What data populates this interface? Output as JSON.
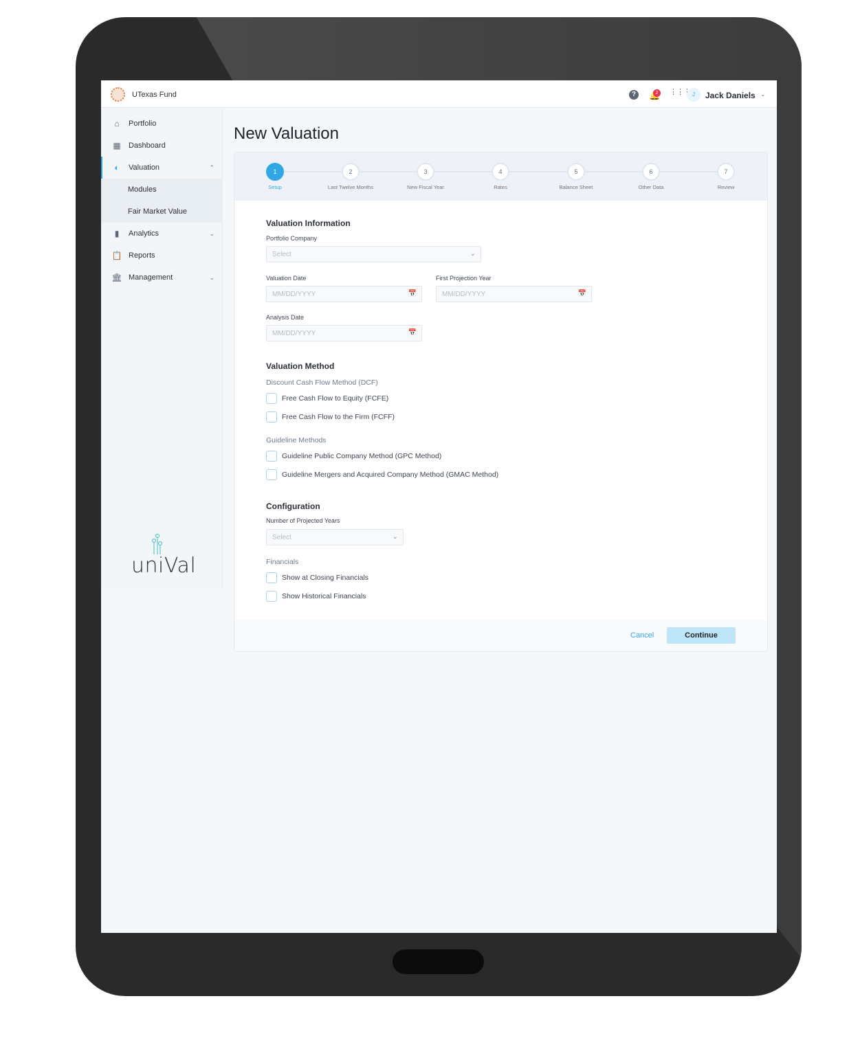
{
  "header": {
    "org_name": "UTexas Fund",
    "notification_count": "2",
    "user_initial": "J",
    "user_name": "Jack Daniels"
  },
  "sidebar": {
    "items": [
      {
        "label": "Portfolio",
        "icon": "home-icon"
      },
      {
        "label": "Dashboard",
        "icon": "dashboard-icon"
      },
      {
        "label": "Valuation",
        "icon": "pie-chart-icon"
      },
      {
        "label": "Modules"
      },
      {
        "label": "Fair Market Value"
      },
      {
        "label": "Analytics",
        "icon": "bar-chart-icon"
      },
      {
        "label": "Reports",
        "icon": "clipboard-icon"
      },
      {
        "label": "Management",
        "icon": "bank-icon"
      }
    ],
    "logo": "uniVal"
  },
  "page": {
    "title": "New Valuation"
  },
  "steps": [
    {
      "n": "1",
      "label": "Setup"
    },
    {
      "n": "2",
      "label": "Last Twelve Months"
    },
    {
      "n": "3",
      "label": "New Fiscal Year"
    },
    {
      "n": "4",
      "label": "Rates"
    },
    {
      "n": "5",
      "label": "Balance Sheet"
    },
    {
      "n": "6",
      "label": "Other Data"
    },
    {
      "n": "7",
      "label": "Review"
    }
  ],
  "form": {
    "info_title": "Valuation Information",
    "portfolio_company_label": "Portfolio Company",
    "portfolio_company_value": "Select",
    "valuation_date_label": "Valuation Date",
    "valuation_date_placeholder": "MM/DD/YYYY",
    "first_projection_label": "First Projection Year",
    "first_projection_placeholder": "MM/DD/YYYY",
    "analysis_date_label": "Analysis Date",
    "analysis_date_placeholder": "MM/DD/YYYY",
    "method_title": "Valuation Method",
    "dcf_label": "Discount Cash Flow Method (DCF)",
    "fcfe": "Free Cash Flow to Equity (FCFE)",
    "fcff": "Free Cash Flow to the Firm (FCFF)",
    "guideline_label": "Guideline Methods",
    "gpc": "Guideline Public Company Method (GPC Method)",
    "gmac": "Guideline Mergers and Acquired Company Method (GMAC Method)",
    "config_title": "Configuration",
    "projected_years_label": "Number of Projected Years",
    "projected_years_value": "Select",
    "financials_label": "Financials",
    "closing": "Show at Closing Financials",
    "historical": "Show Historical Financials"
  },
  "actions": {
    "cancel": "Cancel",
    "continue": "Continue"
  },
  "colors": {
    "accent": "#31a8e6",
    "continue_bg": "#bfe5f8",
    "badge": "#e8334a"
  }
}
